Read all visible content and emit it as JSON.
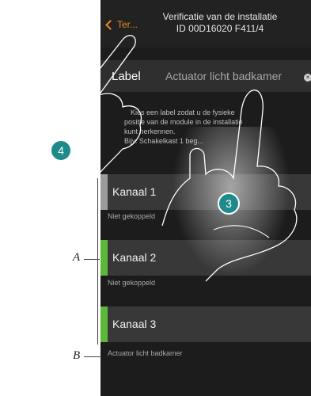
{
  "header": {
    "back_label": "Ter...",
    "title_line1": "Verificatie van de installatie",
    "title_line2": "ID 00D16020 F411/4"
  },
  "label_field": {
    "label": "Label",
    "value": "Actuator licht badkamer"
  },
  "help_lines": [
    "Kies een label zodat u de fysieke",
    "positie van de module in de installatie",
    "kunt herkennen.",
    "Bijv. Schakelkast 1 beg..."
  ],
  "channels": [
    {
      "name": "Kanaal 1",
      "status": "Niet gekoppeld",
      "bar_color": "#9a9a9a"
    },
    {
      "name": "Kanaal 2",
      "status": "Niet gekoppeld",
      "bar_color": "#5bb83a"
    },
    {
      "name": "Kanaal 3",
      "status": "Actuator licht badkamer",
      "bar_color": "#5bb83a"
    }
  ],
  "annotations": {
    "badge_touch_left": "4",
    "badge_touch_right": "3",
    "callout_a": "A",
    "callout_b": "B"
  },
  "colors": {
    "accent": "#e8891c",
    "badge": "#1f8a8a"
  }
}
